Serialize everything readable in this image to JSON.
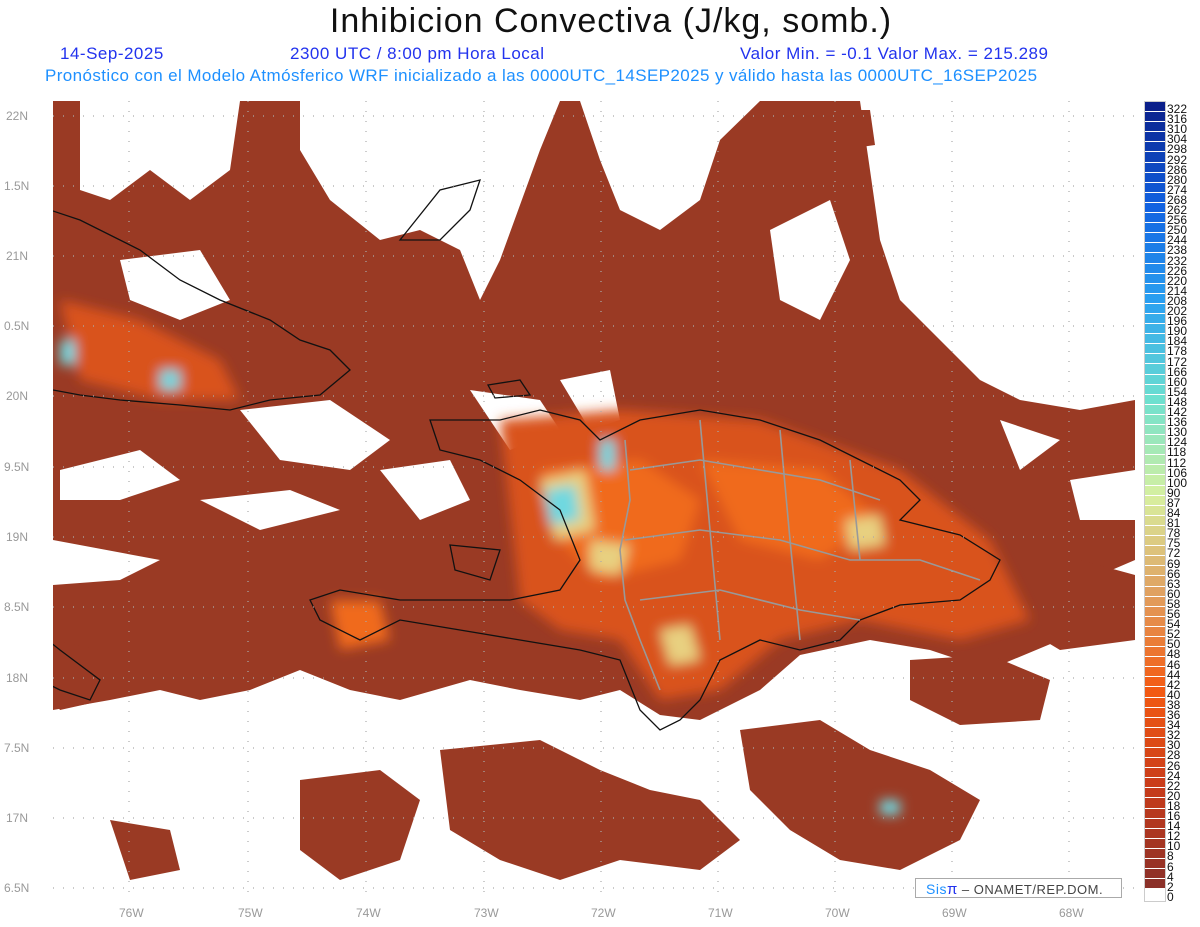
{
  "header": {
    "title": "Inhibicion Convectiva (J/kg, somb.)",
    "date": "14-Sep-2025",
    "time": "2300 UTC / 8:00 pm Hora Local",
    "minmax": "Valor Min. = -0.1  Valor Max. = 215.289",
    "forecast": "Pronóstico con el Modelo Atmósferico WRF inicializado a las 0000UTC_14SEP2025 y válido hasta las  0000UTC_16SEP2025"
  },
  "axes": {
    "lon_labels": [
      "76W",
      "75W",
      "74W",
      "73W",
      "72W",
      "71W",
      "70W",
      "69W",
      "68W"
    ],
    "lat_labels": [
      "22N",
      "1.5N",
      "21N",
      "0.5N",
      "20N",
      "9.5N",
      "19N",
      "8.5N",
      "18N",
      "7.5N",
      "17N",
      "6.5N"
    ]
  },
  "colorbar": {
    "labels": [
      "322",
      "316",
      "310",
      "304",
      "298",
      "292",
      "286",
      "280",
      "274",
      "268",
      "262",
      "256",
      "250",
      "244",
      "238",
      "232",
      "226",
      "220",
      "214",
      "208",
      "202",
      "196",
      "190",
      "184",
      "178",
      "172",
      "166",
      "160",
      "154",
      "148",
      "142",
      "136",
      "130",
      "124",
      "118",
      "112",
      "106",
      "100",
      "90",
      "87",
      "84",
      "81",
      "78",
      "75",
      "72",
      "69",
      "66",
      "63",
      "60",
      "58",
      "56",
      "54",
      "52",
      "50",
      "48",
      "46",
      "44",
      "42",
      "40",
      "38",
      "36",
      "34",
      "32",
      "30",
      "28",
      "26",
      "24",
      "22",
      "20",
      "18",
      "16",
      "14",
      "12",
      "10",
      "8",
      "6",
      "4",
      "2",
      "0"
    ],
    "stops": [
      "#0a1f8a",
      "#1060e0",
      "#2aa0f0",
      "#6de0d0",
      "#d8f0a0",
      "#e0a060",
      "#f35a12",
      "#c83c1a",
      "#8b3028"
    ]
  },
  "colors": {
    "field": "#9a3a24",
    "orange": "#d9521e",
    "bright": "#f06a1e",
    "light": "#e8d080",
    "cyan": "#6fd8e0"
  },
  "logo": {
    "brand": "Sis",
    "pi": "π",
    "rest": " –  ONAMET/REP.DOM."
  }
}
